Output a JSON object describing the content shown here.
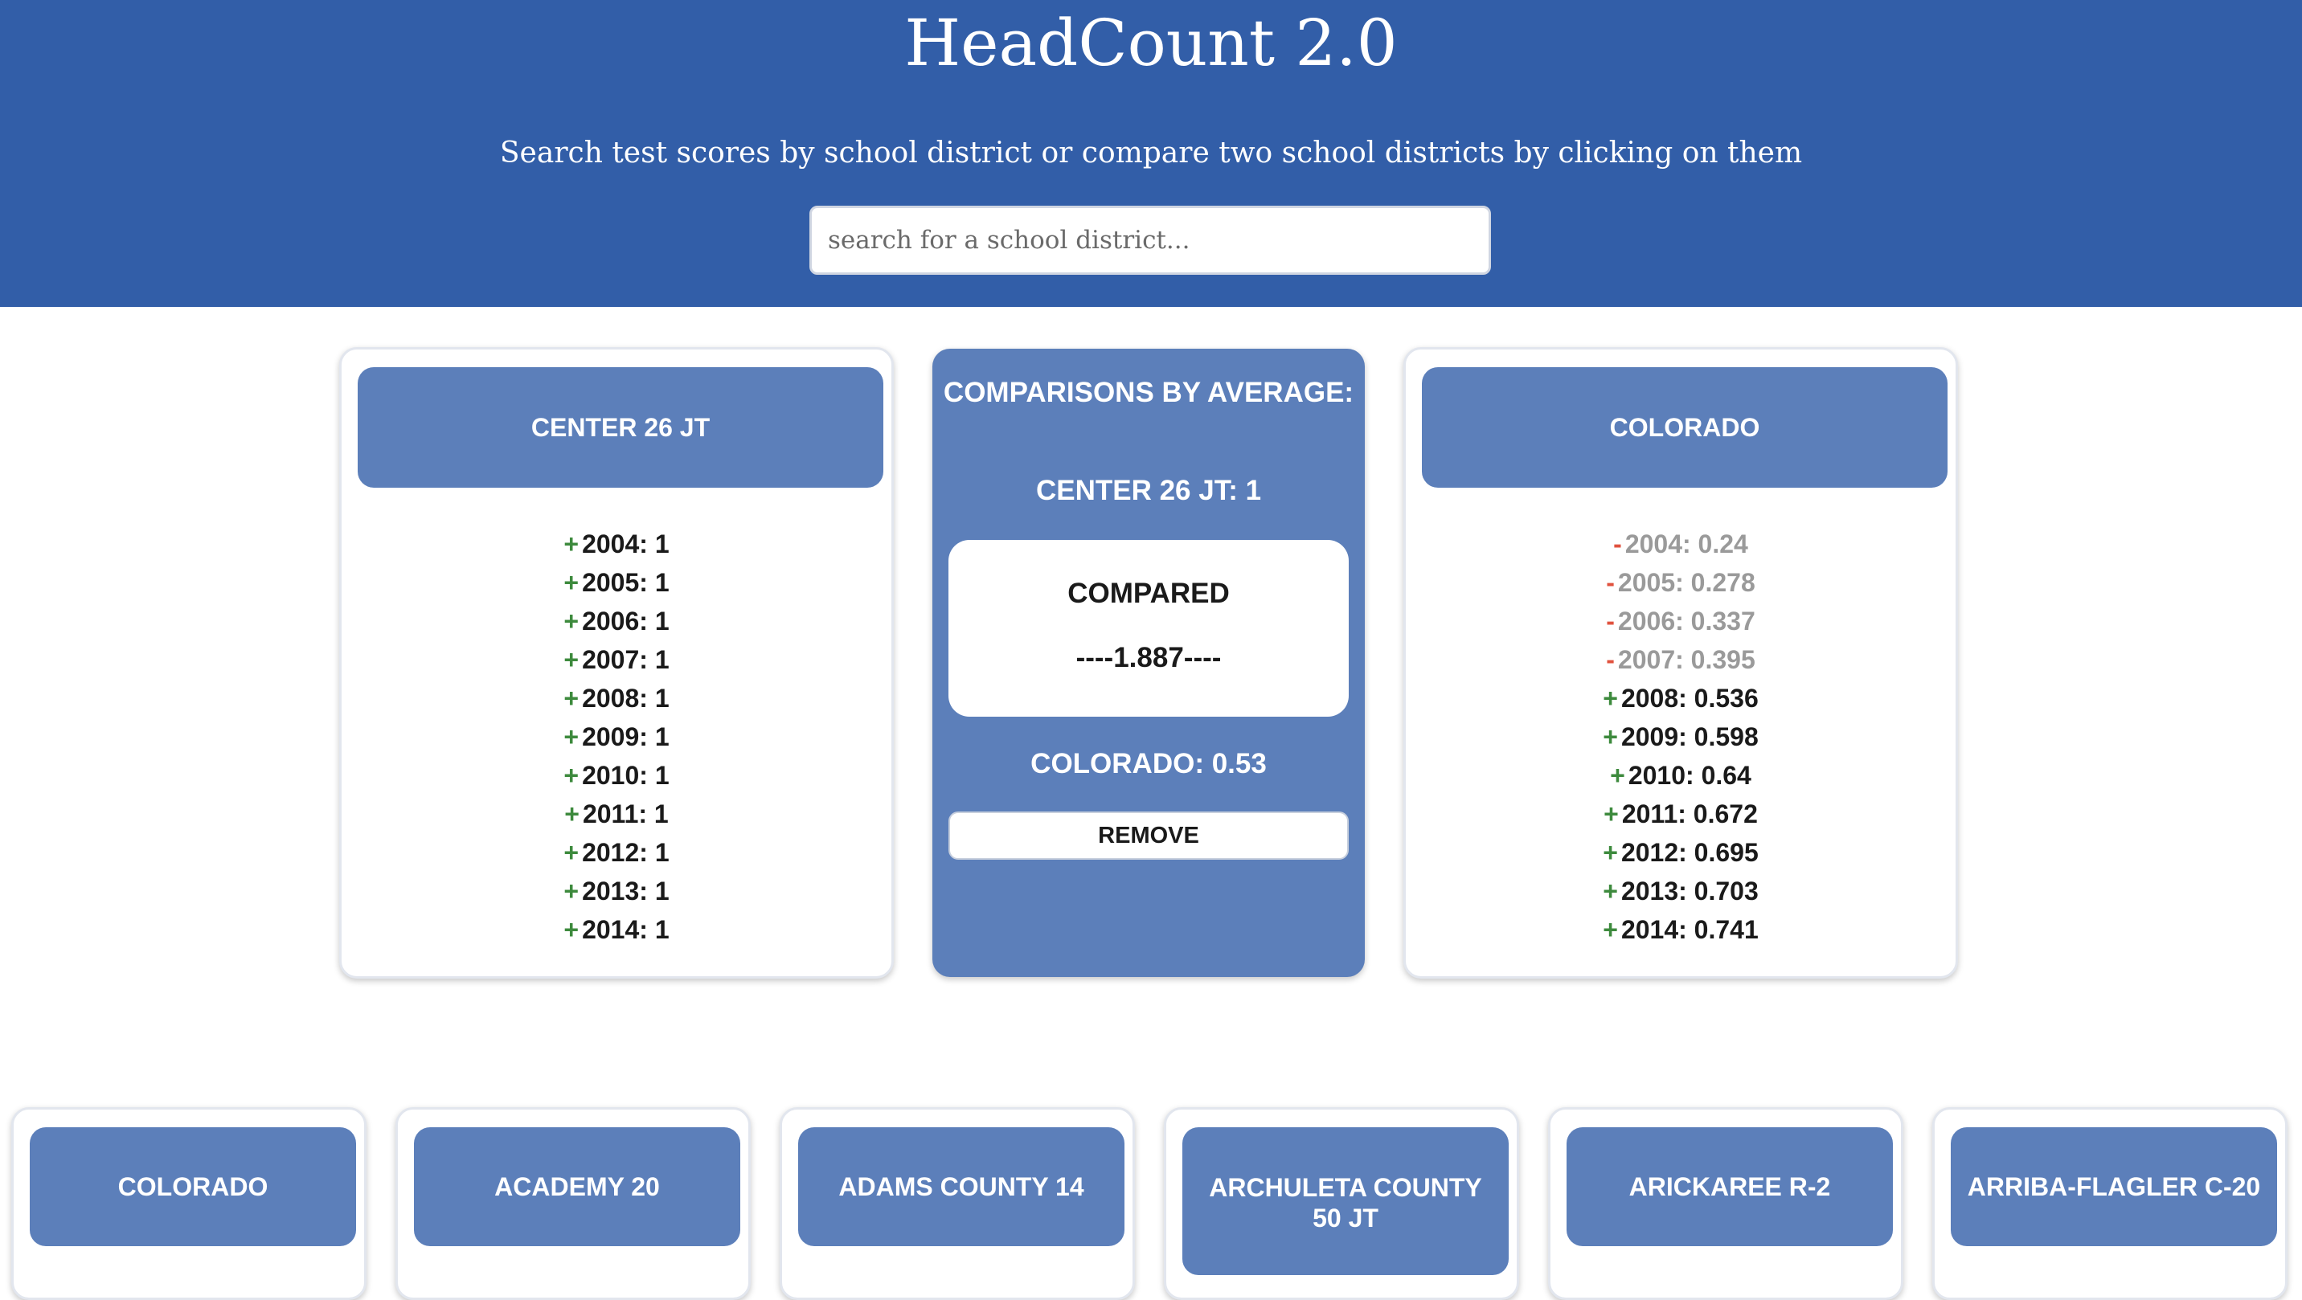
{
  "header": {
    "title": "HeadCount 2.0",
    "subtitle": "Search test scores by school district or compare two school districts by clicking on them",
    "search_placeholder": "search for a school district..."
  },
  "left_card": {
    "name": "CENTER 26 JT",
    "years": [
      {
        "sign": "+",
        "text": "2004: 1"
      },
      {
        "sign": "+",
        "text": "2005: 1"
      },
      {
        "sign": "+",
        "text": "2006: 1"
      },
      {
        "sign": "+",
        "text": "2007: 1"
      },
      {
        "sign": "+",
        "text": "2008: 1"
      },
      {
        "sign": "+",
        "text": "2009: 1"
      },
      {
        "sign": "+",
        "text": "2010: 1"
      },
      {
        "sign": "+",
        "text": "2011: 1"
      },
      {
        "sign": "+",
        "text": "2012: 1"
      },
      {
        "sign": "+",
        "text": "2013: 1"
      },
      {
        "sign": "+",
        "text": "2014: 1"
      }
    ]
  },
  "comparison": {
    "title": "COMPARISONS BY AVERAGE:",
    "district_a": "CENTER 26 JT: 1",
    "compared_label": "COMPARED",
    "compared_value": "----1.887----",
    "district_b": "COLORADO: 0.53",
    "remove_label": "REMOVE"
  },
  "right_card": {
    "name": "COLORADO",
    "years": [
      {
        "sign": "-",
        "text": "2004: 0.24"
      },
      {
        "sign": "-",
        "text": "2005: 0.278"
      },
      {
        "sign": "-",
        "text": "2006: 0.337"
      },
      {
        "sign": "-",
        "text": "2007: 0.395"
      },
      {
        "sign": "+",
        "text": "2008: 0.536"
      },
      {
        "sign": "+",
        "text": "2009: 0.598"
      },
      {
        "sign": "+",
        "text": "2010: 0.64"
      },
      {
        "sign": "+",
        "text": "2011: 0.672"
      },
      {
        "sign": "+",
        "text": "2012: 0.695"
      },
      {
        "sign": "+",
        "text": "2013: 0.703"
      },
      {
        "sign": "+",
        "text": "2014: 0.741"
      }
    ]
  },
  "districts": [
    {
      "name": "COLORADO"
    },
    {
      "name": "ACADEMY 20"
    },
    {
      "name": "ADAMS COUNTY 14"
    },
    {
      "name": "ARCHULETA COUNTY 50 JT"
    },
    {
      "name": "ARICKAREE R-2"
    },
    {
      "name": "ARRIBA-FLAGLER C-20"
    }
  ],
  "colors": {
    "header_bg": "#325ea8",
    "card_head": "#5c7fba",
    "positive": "#3d8a3d",
    "negative": "#e0523e"
  }
}
